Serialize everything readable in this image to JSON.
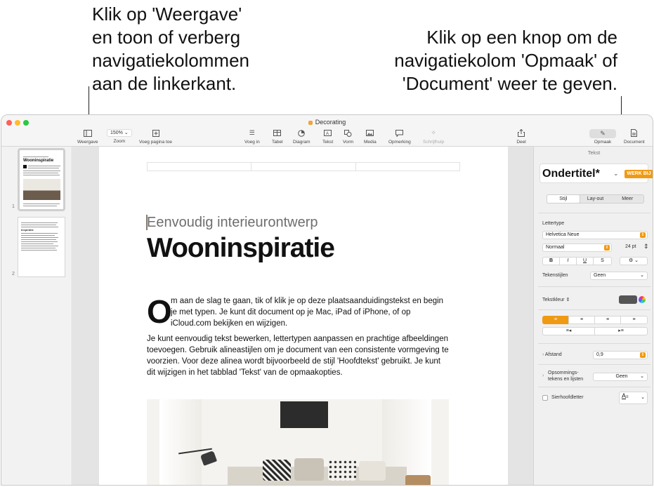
{
  "callouts": {
    "left": [
      "Klik op 'Weergave'",
      "en toon of verberg",
      "navigatiekolommen",
      "aan de linkerkant."
    ],
    "right": [
      "Klik op een knop om de",
      "navigatiekolom 'Opmaak' of",
      "'Document' weer te geven."
    ]
  },
  "window": {
    "title": "Decorating",
    "traffic_colors": [
      "#fe5f57",
      "#febc2e",
      "#28c840"
    ]
  },
  "toolbar": {
    "view_label": "Weergave",
    "zoom_value": "150%",
    "zoom_label": "Zoom",
    "add_page_label": "Voeg pagina toe",
    "insert_label": "Voeg in",
    "table_label": "Tabel",
    "chart_label": "Diagram",
    "text_label": "Tekst",
    "shape_label": "Vorm",
    "media_label": "Media",
    "comment_label": "Opmerking",
    "writing_tools_label": "Schrijfhulp",
    "share_label": "Deel",
    "format_label": "Opmaak",
    "document_label": "Document"
  },
  "sidebar": {
    "pages": [
      {
        "number": "1",
        "title": "Wooninspiratie"
      },
      {
        "number": "2",
        "title": "Inspiratie"
      }
    ]
  },
  "document": {
    "subtitle": "Eenvoudig interieurontwerp",
    "title": "Wooninspiratie",
    "drop_cap": "O",
    "paragraph1": "m aan de slag te gaan, tik of klik je op deze plaatsaanduidingstekst en begin je met typen. Je kunt dit document op je Mac, iPad of iPhone, of op iCloud.com bekijken en wijzigen.",
    "paragraph2": "Je kunt eenvoudig tekst bewerken, lettertypen aanpassen en prachtige afbeeldingen toevoegen. Gebruik alineastijlen om je document van een consistente vormgeving te voorzien. Voor deze alinea wordt bijvoorbeeld de stijl 'Hoofdtekst' gebruikt. Je kunt dit wijzigen in het tabblad 'Tekst' van de opmaakopties."
  },
  "inspector": {
    "header": "Tekst",
    "paragraph_style": "Ondertitel*",
    "update_button": "WERK BIJ",
    "tabs": [
      "Stijl",
      "Lay-out",
      "Meer"
    ],
    "font_section": "Lettertype",
    "font_family": "Helvetica Neue",
    "font_weight": "Normaal",
    "font_size": "24 pt",
    "format_buttons": [
      "B",
      "I",
      "U",
      "S"
    ],
    "char_styles_label": "Tekenstijlen",
    "char_styles_value": "Geen",
    "text_color_label": "Tekstkleur",
    "text_color": "#555555",
    "spacing_label": "Afstand",
    "spacing_value": "0,9",
    "bullets_label_line1": "Opsommings-",
    "bullets_label_line2": "tekens en lijsten",
    "bullets_value": "Geen",
    "dropcap_label": "Sierhoofdletter",
    "dropcap_preview": "A"
  },
  "accent_color": "#f09a14"
}
